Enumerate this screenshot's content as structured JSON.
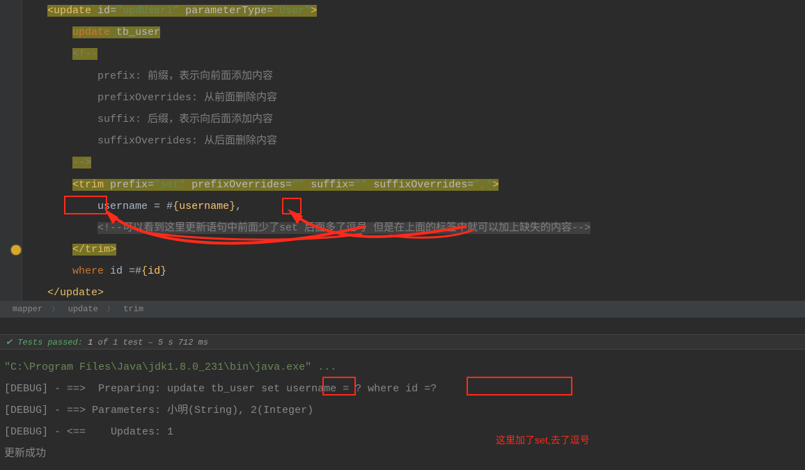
{
  "code": {
    "l1": {
      "tag_open": "<update",
      "attr1": "id",
      "v1": "\"updUser1\"",
      "attr2": "parameterType",
      "v2": "\"User\"",
      "close": ">"
    },
    "l2": {
      "kw": "update",
      "ident": " tb_user"
    },
    "l3": "<!--",
    "l4": "prefix: 前缀，表示向前面添加内容",
    "l5": "prefixOverrides: 从前面删除内容",
    "l6": "suffix: 后缀，表示向后面添加内容",
    "l7": "suffixOverrides: 从后面删除内容",
    "l8": "-->",
    "l9": {
      "tag_open": "<trim",
      "a1": "prefix",
      "v1": "\"set\"",
      "a2": "prefixOverrides",
      "v2": "\"\"",
      "a3": "suffix",
      "v3": "\"\"",
      "a4": "suffixOverrides",
      "v4": "\",\"",
      "close": ">"
    },
    "l10": {
      "text": "username = #",
      "lb": "{",
      "param": "username",
      "rb": "}",
      "comma": ","
    },
    "l11": "<!--可以看到这里更新语句中前面少了set 后面多了逗号 但是在上面的标签中就可以加上缺失的内容-->",
    "l12": "</trim>",
    "l13": {
      "kw": "where",
      "text": " id =#",
      "lb": "{",
      "param": "id",
      "rb": "}"
    },
    "l14": "</update>"
  },
  "breadcrumbs": [
    "mapper",
    "update",
    "trim"
  ],
  "tests": {
    "label": "Tests passed:",
    "count": "1",
    "rest": "of 1 test – 5 s 712 ms"
  },
  "console": {
    "c1": "\"C:\\Program Files\\Java\\jdk1.8.0_231\\bin\\java.exe\" ...",
    "c2a": "[DEBUG] - ==>  Preparing: update tb_user ",
    "c2b": "set",
    "c2c": " username = ? ",
    "c2d": "where id =?",
    "c3": "[DEBUG] - ==> Parameters: 小明(String), 2(Integer)",
    "c4": "[DEBUG] - <==    Updates: 1",
    "c5": "更新成功"
  },
  "annotations": {
    "red_text": "这里加了set,去了逗号"
  }
}
